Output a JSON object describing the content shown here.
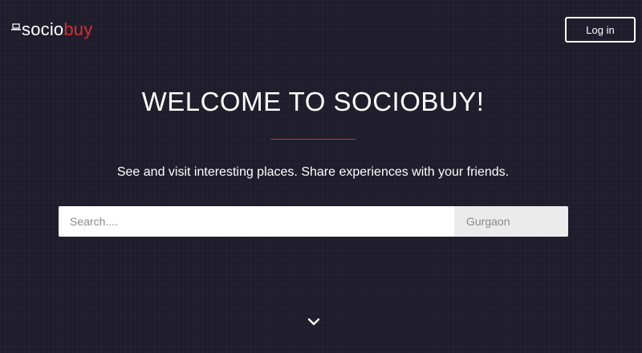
{
  "brand": {
    "part1": "socio",
    "part2": "buy",
    "accent_color": "#d32f2f"
  },
  "header": {
    "login_label": "Log in"
  },
  "hero": {
    "title": "WELCOME TO SOCIOBUY!",
    "tagline": "See and visit interesting places. Share experiences with your friends."
  },
  "search": {
    "placeholder": "Search....",
    "location": "Gurgaon"
  },
  "icons": {
    "logo": "laptop-icon",
    "scroll": "chevron-down-icon"
  }
}
